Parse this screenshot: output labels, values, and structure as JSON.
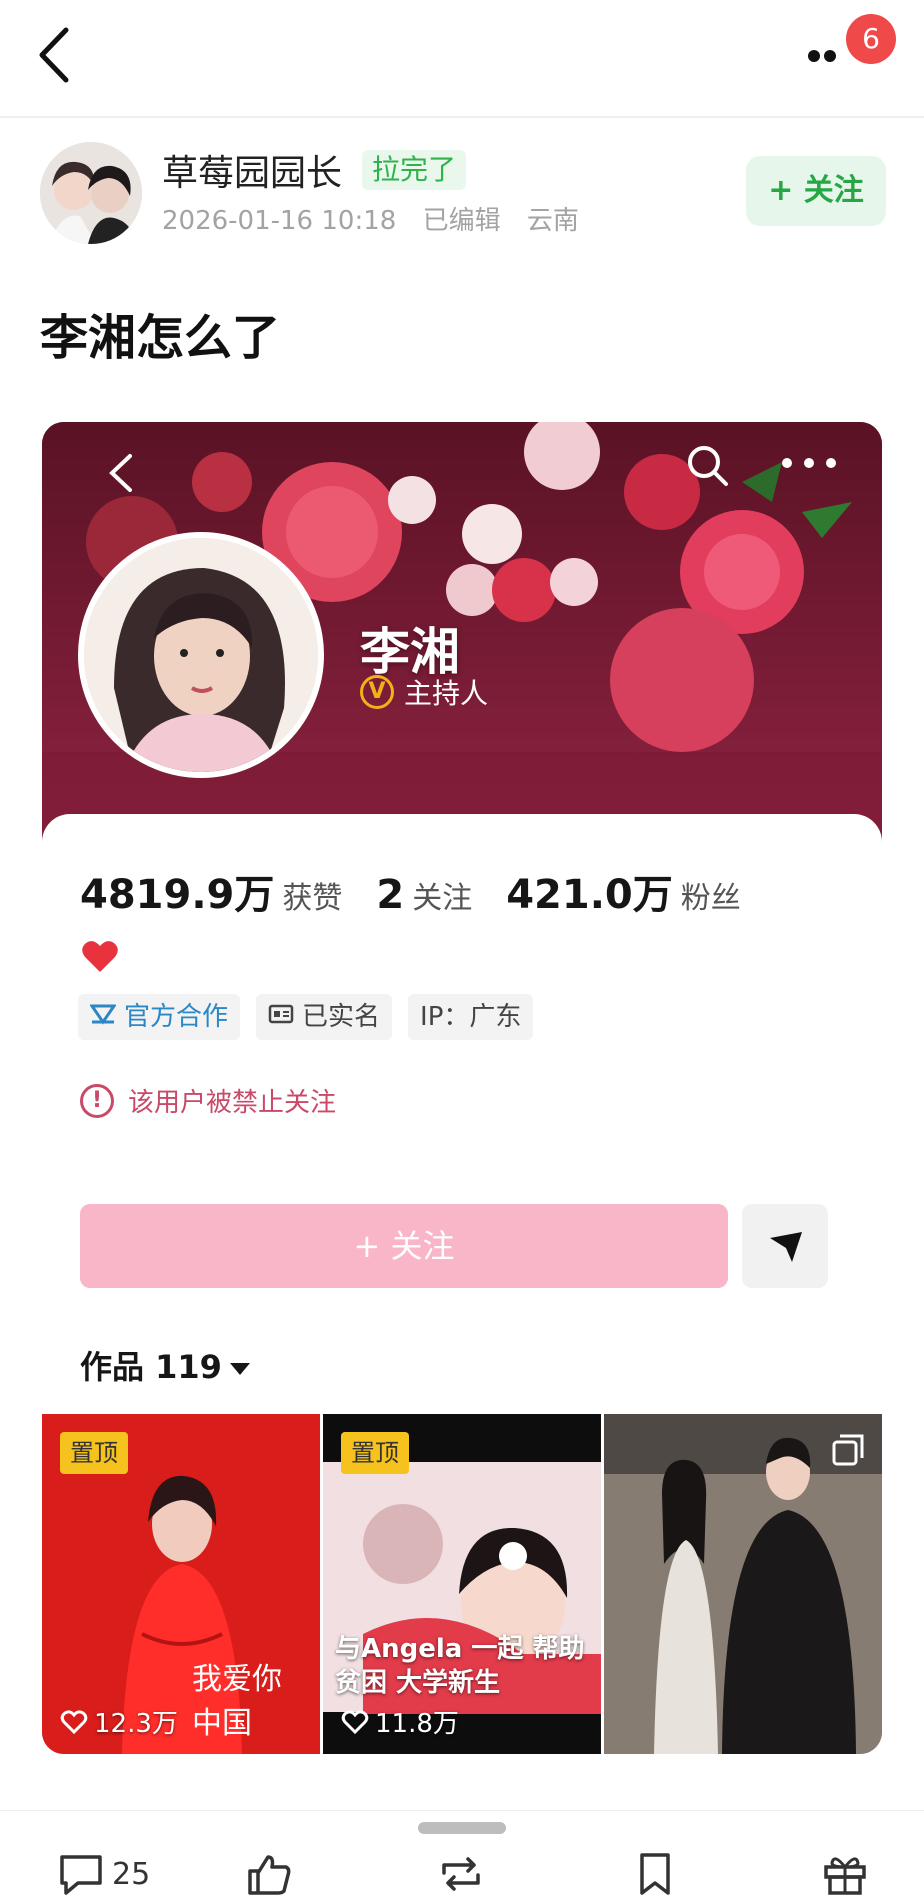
{
  "topbar": {
    "notification_count": "6"
  },
  "post": {
    "author": "草莓园园长",
    "level_badge": "拉完了",
    "date": "2026-01-16 10:18",
    "edited": "已编辑",
    "location": "云南",
    "follow_label": "+ 关注",
    "title": "李湘怎么了"
  },
  "profile": {
    "name": "李湘",
    "role": "主持人",
    "stats": [
      {
        "num": "4819.9万",
        "label": "获赞"
      },
      {
        "num": "2",
        "label": "关注"
      },
      {
        "num": "421.0万",
        "label": "粉丝"
      }
    ],
    "tags": [
      "官方合作",
      "已实名",
      "IP：广东"
    ],
    "blocked_text": "该用户被禁止关注",
    "follow_label": "+ 关注",
    "works_label": "作品 119",
    "thumbs": [
      {
        "pin": "置顶",
        "likes": "12.3万",
        "callig": "我爱你 中国"
      },
      {
        "pin": "置顶",
        "likes": "11.8万",
        "caption": "与Angela 一起 帮助贫困 大学新生"
      },
      {
        "likes": ""
      }
    ]
  },
  "bottom": {
    "comment_count": "25"
  },
  "colors": {
    "accent_green": "#26a744",
    "pink": "#f8b6c8",
    "badge_red": "#f0494a",
    "block_red": "#c84a68"
  }
}
